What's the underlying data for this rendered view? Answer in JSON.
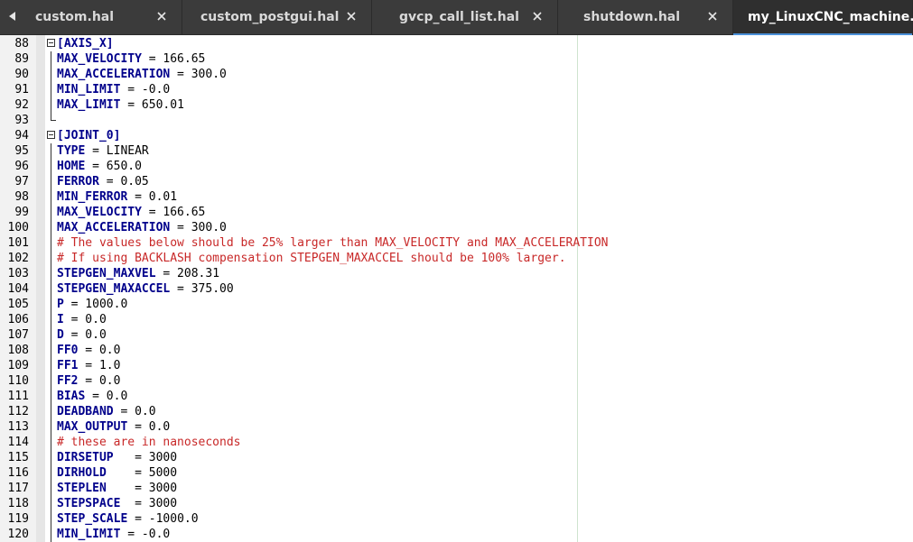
{
  "tabs": [
    {
      "label": "custom.hal",
      "active": false
    },
    {
      "label": "custom_postgui.hal",
      "active": false
    },
    {
      "label": "gvcp_call_list.hal",
      "active": false
    },
    {
      "label": "shutdown.hal",
      "active": false
    },
    {
      "label": "my_LinuxCNC_machine.ini",
      "active": true
    }
  ],
  "icons": {
    "scroll_left": "triangle-left-icon",
    "close": "close-x-icon",
    "fold_open": "minus-box-icon"
  },
  "colors": {
    "tabbar_bg": "#3b3b3b",
    "active_tab_underline": "#4a90d9",
    "section_header": "#00008b",
    "key": "#00008b",
    "comment": "#c82828",
    "gutter_bg": "#f2f2f2"
  },
  "editor": {
    "lines": [
      {
        "n": "88",
        "type": "section",
        "text": "[AXIS_X]",
        "fold": "start"
      },
      {
        "n": "89",
        "type": "kv",
        "key": "MAX_VELOCITY",
        "rest": " = 166.65",
        "fold": "bar"
      },
      {
        "n": "90",
        "type": "kv",
        "key": "MAX_ACCELERATION",
        "rest": " = 300.0",
        "fold": "bar"
      },
      {
        "n": "91",
        "type": "kv",
        "key": "MIN_LIMIT",
        "rest": " = -0.0",
        "fold": "bar"
      },
      {
        "n": "92",
        "type": "kv",
        "key": "MAX_LIMIT",
        "rest": " = 650.01",
        "fold": "bar"
      },
      {
        "n": "93",
        "type": "blank",
        "text": "",
        "fold": "end"
      },
      {
        "n": "94",
        "type": "section",
        "text": "[JOINT_0]",
        "fold": "start"
      },
      {
        "n": "95",
        "type": "kv",
        "key": "TYPE",
        "rest": " = LINEAR",
        "fold": "bar"
      },
      {
        "n": "96",
        "type": "kv",
        "key": "HOME",
        "rest": " = 650.0",
        "fold": "bar"
      },
      {
        "n": "97",
        "type": "kv",
        "key": "FERROR",
        "rest": " = 0.05",
        "fold": "bar"
      },
      {
        "n": "98",
        "type": "kv",
        "key": "MIN_FERROR",
        "rest": " = 0.01",
        "fold": "bar"
      },
      {
        "n": "99",
        "type": "kv",
        "key": "MAX_VELOCITY",
        "rest": " = 166.65",
        "fold": "bar"
      },
      {
        "n": "100",
        "type": "kv",
        "key": "MAX_ACCELERATION",
        "rest": " = 300.0",
        "fold": "bar"
      },
      {
        "n": "101",
        "type": "comment",
        "text": "# The values below should be 25% larger than MAX_VELOCITY and MAX_ACCELERATION",
        "fold": "bar"
      },
      {
        "n": "102",
        "type": "comment",
        "text": "# If using BACKLASH compensation STEPGEN_MAXACCEL should be 100% larger.",
        "fold": "bar"
      },
      {
        "n": "103",
        "type": "kv",
        "key": "STEPGEN_MAXVEL",
        "rest": " = 208.31",
        "fold": "bar"
      },
      {
        "n": "104",
        "type": "kv",
        "key": "STEPGEN_MAXACCEL",
        "rest": " = 375.00",
        "fold": "bar"
      },
      {
        "n": "105",
        "type": "kv",
        "key": "P",
        "rest": " = 1000.0",
        "fold": "bar"
      },
      {
        "n": "106",
        "type": "kv",
        "key": "I",
        "rest": " = 0.0",
        "fold": "bar"
      },
      {
        "n": "107",
        "type": "kv",
        "key": "D",
        "rest": " = 0.0",
        "fold": "bar"
      },
      {
        "n": "108",
        "type": "kv",
        "key": "FF0",
        "rest": " = 0.0",
        "fold": "bar"
      },
      {
        "n": "109",
        "type": "kv",
        "key": "FF1",
        "rest": " = 1.0",
        "fold": "bar"
      },
      {
        "n": "110",
        "type": "kv",
        "key": "FF2",
        "rest": " = 0.0",
        "fold": "bar"
      },
      {
        "n": "111",
        "type": "kv",
        "key": "BIAS",
        "rest": " = 0.0",
        "fold": "bar"
      },
      {
        "n": "112",
        "type": "kv",
        "key": "DEADBAND",
        "rest": " = 0.0",
        "fold": "bar"
      },
      {
        "n": "113",
        "type": "kv",
        "key": "MAX_OUTPUT",
        "rest": " = 0.0",
        "fold": "bar"
      },
      {
        "n": "114",
        "type": "comment",
        "text": "# these are in nanoseconds",
        "fold": "bar"
      },
      {
        "n": "115",
        "type": "kv",
        "key": "DIRSETUP",
        "rest": "   = 3000",
        "fold": "bar"
      },
      {
        "n": "116",
        "type": "kv",
        "key": "DIRHOLD",
        "rest": "    = 5000",
        "fold": "bar"
      },
      {
        "n": "117",
        "type": "kv",
        "key": "STEPLEN",
        "rest": "    = 3000",
        "fold": "bar"
      },
      {
        "n": "118",
        "type": "kv",
        "key": "STEPSPACE",
        "rest": "  = 3000",
        "fold": "bar"
      },
      {
        "n": "119",
        "type": "kv",
        "key": "STEP_SCALE",
        "rest": " = -1000.0",
        "fold": "bar"
      },
      {
        "n": "120",
        "type": "kv",
        "key": "MIN_LIMIT",
        "rest": " = -0.0",
        "fold": "bar"
      }
    ]
  }
}
